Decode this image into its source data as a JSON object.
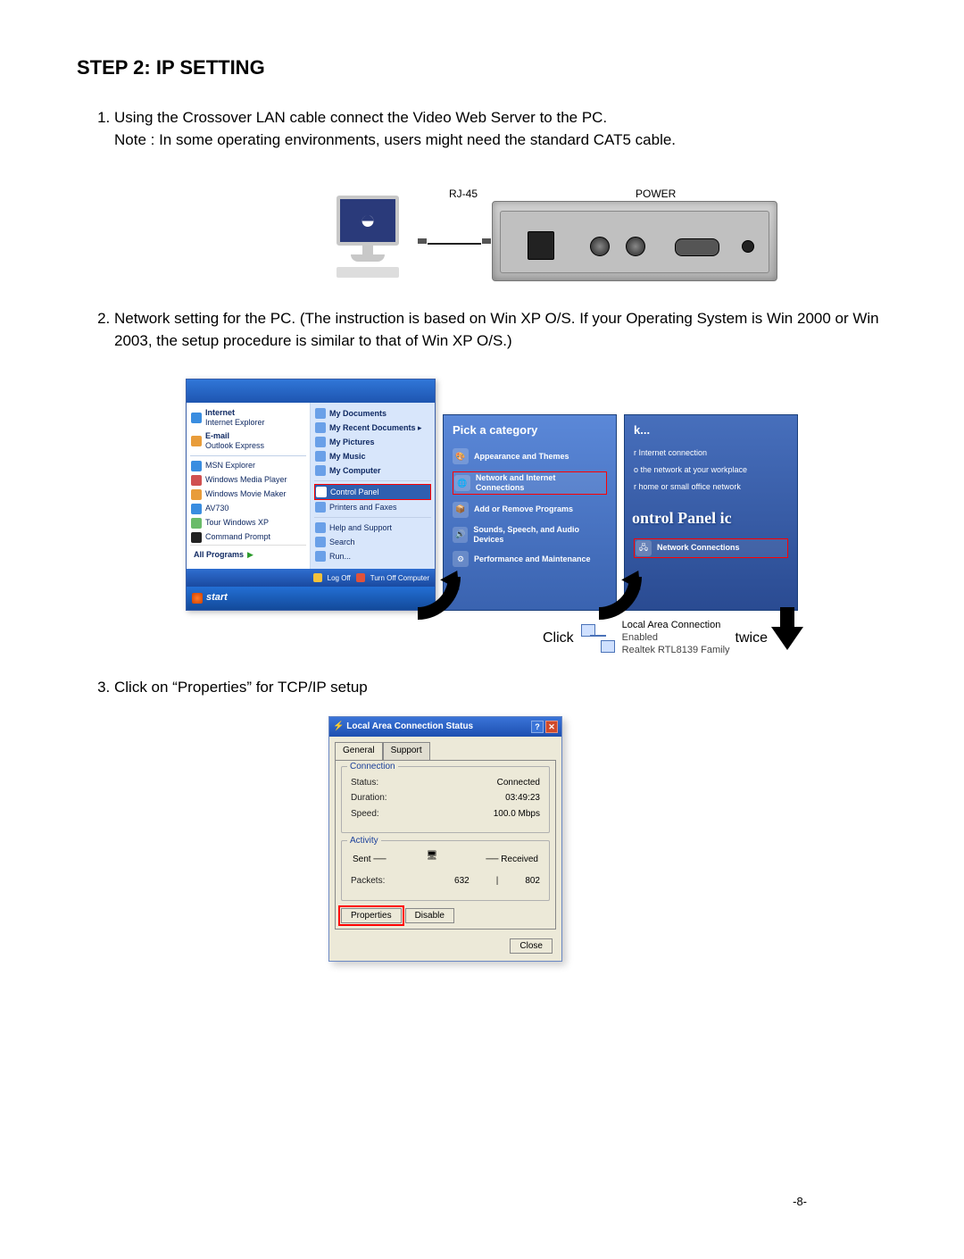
{
  "heading": "STEP 2:  IP SETTING",
  "step1_a": "Using the Crossover LAN cable connect the Video Web Server to the PC.",
  "step1_b": "Note : In some operating environments, users might need the standard CAT5 cable.",
  "diag": {
    "rj45": "RJ-45",
    "power": "POWER"
  },
  "step2": "Network setting for the PC. (The instruction is based on Win XP O/S. If your Operating System is Win 2000 or  Win 2003, the setup procedure is similar to that of Win XP O/S.)",
  "startmenu": {
    "left": {
      "internet": "Internet",
      "internet_sub": "Internet Explorer",
      "email": "E-mail",
      "email_sub": "Outlook Express",
      "msn": "MSN Explorer",
      "wmp": "Windows Media Player",
      "wmm": "Windows Movie Maker",
      "av": "AV730",
      "tour": "Tour Windows XP",
      "cmd": "Command Prompt",
      "allprograms": "All Programs"
    },
    "right": {
      "docs": "My Documents",
      "recent": "My Recent Documents",
      "pics": "My Pictures",
      "music": "My Music",
      "comp": "My Computer",
      "cpanel": "Control Panel",
      "printers": "Printers and Faxes",
      "help": "Help and Support",
      "search": "Search",
      "run": "Run..."
    },
    "logoff": "Log Off",
    "turnoff": "Turn Off Computer",
    "start": "start"
  },
  "categoryPanel": {
    "title": "Pick a category",
    "items": {
      "app": "Appearance and Themes",
      "net": "Network and Internet Connections",
      "addrem": "Add or Remove Programs",
      "sounds": "Sounds, Speech, and Audio Devices",
      "perf": "Performance and Maintenance"
    }
  },
  "taskPanel": {
    "title_suffix": "k...",
    "items": {
      "i1": "r Internet connection",
      "i2": "o the network at your workplace",
      "i3": "r home or small office network"
    },
    "cp_title": "ontrol Panel ic",
    "netcon": "Network Connections"
  },
  "lac": {
    "click": "Click",
    "twice": "twice",
    "line1": "Local Area Connection",
    "line2": "Enabled",
    "line3": "Realtek RTL8139 Family"
  },
  "step3": "Click on “Properties” for TCP/IP setup",
  "dialog": {
    "title": "Local Area Connection Status",
    "tab_general": "General",
    "tab_support": "Support",
    "grp_conn": "Connection",
    "status_l": "Status:",
    "status_v": "Connected",
    "dur_l": "Duration:",
    "dur_v": "03:49:23",
    "speed_l": "Speed:",
    "speed_v": "100.0 Mbps",
    "grp_act": "Activity",
    "sent": "Sent",
    "recv": "Received",
    "pkts_l": "Packets:",
    "pkts_sent": "632",
    "pkts_recv": "802",
    "btn_props": "Properties",
    "btn_disable": "Disable",
    "btn_close": "Close"
  },
  "pagenum": "-8-"
}
